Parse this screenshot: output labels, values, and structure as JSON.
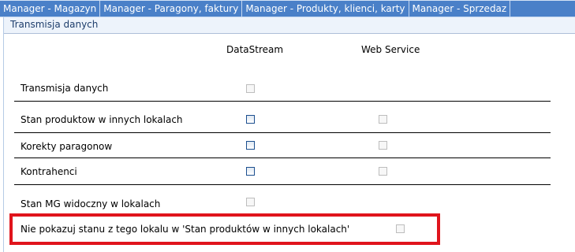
{
  "tabs": [
    "Manager - Magazyn",
    "Manager - Paragony, faktury",
    "Manager - Produkty, klienci, karty",
    "Manager - Sprzedaz"
  ],
  "section": {
    "title": "Transmisja danych"
  },
  "columns": {
    "datastream": "DataStream",
    "webservice": "Web Service"
  },
  "rows": [
    {
      "label": "Transmisja danych",
      "datastream_checked": false,
      "webservice_checked": null
    },
    {
      "label": "Stan produktow w innych lokalach",
      "datastream_checked": false,
      "webservice_checked": false
    },
    {
      "label": "Korekty paragonow",
      "datastream_checked": false,
      "webservice_checked": false
    },
    {
      "label": "Kontrahenci",
      "datastream_checked": false,
      "webservice_checked": false
    },
    {
      "label": "Stan MG widoczny w lokalach",
      "datastream_checked": false,
      "webservice_checked": null
    }
  ],
  "highlighted_option": {
    "label": "Nie pokazuj stanu z tego lokalu w 'Stan produktów w innych lokalach'",
    "checked": false
  },
  "highlight_color": "#e0141c",
  "tab_bar_color": "#4a80c8"
}
